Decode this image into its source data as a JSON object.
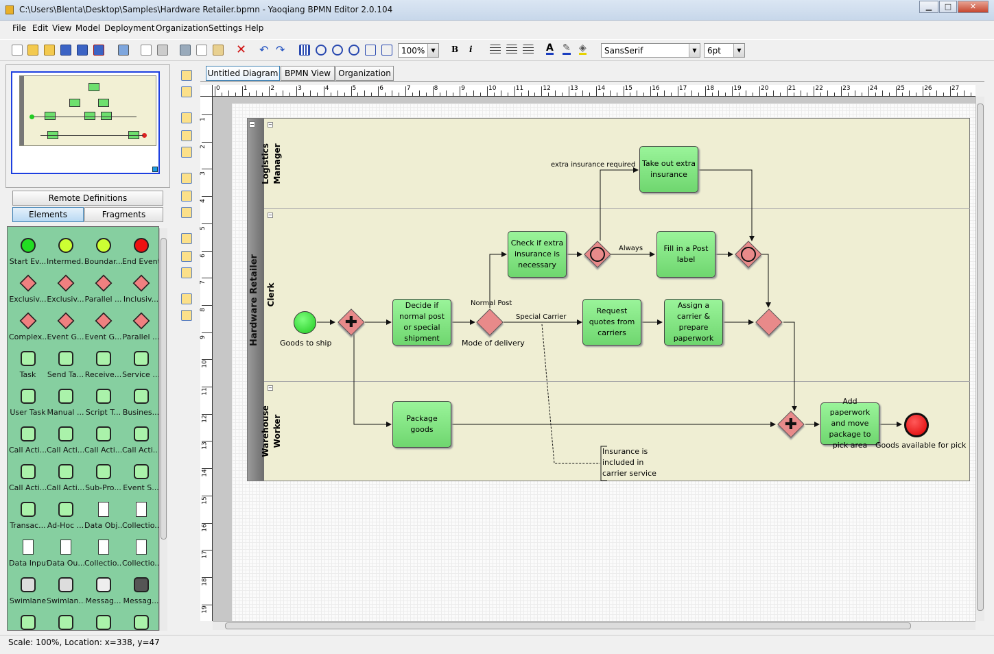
{
  "window": {
    "title": "C:\\Users\\Blenta\\Desktop\\Samples\\Hardware Retailer.bpmn - Yaoqiang BPMN Editor 2.0.104",
    "min": "▁",
    "max": "□",
    "close": "✕"
  },
  "menu": [
    "File",
    "Edit",
    "View",
    "Model",
    "Deployment",
    "Organization",
    "Settings",
    "Help"
  ],
  "toolbar": {
    "zoom": "100%",
    "font": "SansSerif",
    "size": "6pt",
    "bold": "B",
    "italic": "i",
    "dropdown": "▼"
  },
  "left": {
    "remote": "Remote Definitions",
    "tabs": [
      "Elements",
      "Fragments"
    ]
  },
  "palette": [
    {
      "label": "Start Ev...",
      "color": "#22dd22",
      "icon": "start-event-icon"
    },
    {
      "label": "Intermed...",
      "color": "#ccff33",
      "icon": "intermediate-event-icon"
    },
    {
      "label": "Boundar...",
      "color": "#ccff33",
      "icon": "boundary-event-icon"
    },
    {
      "label": "End Event",
      "color": "#ee1111",
      "icon": "end-event-icon"
    },
    {
      "label": "Exclusiv...",
      "color": "#f08080",
      "icon": "exclusive-gateway-icon"
    },
    {
      "label": "Exclusiv...",
      "color": "#f08080",
      "icon": "exclusive-x-gateway-icon"
    },
    {
      "label": "Parallel ...",
      "color": "#f08080",
      "icon": "parallel-gateway-icon"
    },
    {
      "label": "Inclusiv...",
      "color": "#f08080",
      "icon": "inclusive-gateway-icon"
    },
    {
      "label": "Complex...",
      "color": "#f08080",
      "icon": "complex-gateway-icon"
    },
    {
      "label": "Event G...",
      "color": "#f08080",
      "icon": "event-gateway-icon"
    },
    {
      "label": "Event G...",
      "color": "#f08080",
      "icon": "event-gateway-2-icon"
    },
    {
      "label": "Parallel ...",
      "color": "#f08080",
      "icon": "parallel-event-gateway-icon"
    },
    {
      "label": "Task",
      "color": "#aaf2aa",
      "icon": "task-icon"
    },
    {
      "label": "Send Ta...",
      "color": "#aaf2aa",
      "icon": "send-task-icon"
    },
    {
      "label": "Receive...",
      "color": "#aaf2aa",
      "icon": "receive-task-icon"
    },
    {
      "label": "Service ...",
      "color": "#aaf2aa",
      "icon": "service-task-icon"
    },
    {
      "label": "User Task",
      "color": "#aaf2aa",
      "icon": "user-task-icon"
    },
    {
      "label": "Manual ...",
      "color": "#aaf2aa",
      "icon": "manual-task-icon"
    },
    {
      "label": "Script T...",
      "color": "#aaf2aa",
      "icon": "script-task-icon"
    },
    {
      "label": "Busines...",
      "color": "#aaf2aa",
      "icon": "business-rule-task-icon"
    },
    {
      "label": "Call Acti...",
      "color": "#aaf2aa",
      "icon": "call-activity-icon"
    },
    {
      "label": "Call Acti...",
      "color": "#aaf2aa",
      "icon": "call-activity-user-icon"
    },
    {
      "label": "Call Acti...",
      "color": "#aaf2aa",
      "icon": "call-activity-manual-icon"
    },
    {
      "label": "Call Acti...",
      "color": "#aaf2aa",
      "icon": "call-activity-script-icon"
    },
    {
      "label": "Call Acti...",
      "color": "#aaf2aa",
      "icon": "call-activity-rule-icon"
    },
    {
      "label": "Call Acti...",
      "color": "#aaf2aa",
      "icon": "call-activity-process-icon"
    },
    {
      "label": "Sub-Pro...",
      "color": "#aaf2aa",
      "icon": "sub-process-icon"
    },
    {
      "label": "Event S...",
      "color": "#aaf2aa",
      "icon": "event-sub-process-icon"
    },
    {
      "label": "Transac...",
      "color": "#aaf2aa",
      "icon": "transaction-icon"
    },
    {
      "label": "Ad-Hoc ...",
      "color": "#aaf2aa",
      "icon": "ad-hoc-icon"
    },
    {
      "label": "Data Obj...",
      "color": "#ffffff",
      "icon": "data-object-icon"
    },
    {
      "label": "Collectio...",
      "color": "#ffffff",
      "icon": "data-collection-icon"
    },
    {
      "label": "Data Input",
      "color": "#ffffff",
      "icon": "data-input-icon"
    },
    {
      "label": "Data Ou...",
      "color": "#ffffff",
      "icon": "data-output-icon"
    },
    {
      "label": "Collectio...",
      "color": "#ffffff",
      "icon": "input-collection-icon"
    },
    {
      "label": "Collectio...",
      "color": "#ffffff",
      "icon": "output-collection-icon"
    },
    {
      "label": "Swimlane",
      "color": "#dddddd",
      "icon": "swimlane-icon"
    },
    {
      "label": "Swimlan...",
      "color": "#dddddd",
      "icon": "swimlane-vertical-icon"
    },
    {
      "label": "Messag...",
      "color": "#eeeeee",
      "icon": "message-icon"
    },
    {
      "label": "Messag...",
      "color": "#555555",
      "icon": "message-filled-icon"
    },
    {
      "label": "",
      "color": "#aaf2aa",
      "icon": "task-partial-icon"
    },
    {
      "label": "",
      "color": "#aaf2aa",
      "icon": "task-partial-2-icon"
    },
    {
      "label": "",
      "color": "#aaf2aa",
      "icon": "task-partial-3-icon"
    },
    {
      "label": "",
      "color": "#aaf2aa",
      "icon": "task-partial-4-icon"
    }
  ],
  "tabs": [
    "Untitled Diagram",
    "BPMN View",
    "Organization"
  ],
  "ruler": [
    "0",
    "1",
    "2",
    "3",
    "4",
    "5",
    "6",
    "7",
    "8",
    "9",
    "10",
    "11",
    "12",
    "13",
    "14",
    "15",
    "16",
    "17",
    "18",
    "19",
    "20",
    "21",
    "22",
    "23",
    "24",
    "25",
    "26",
    "27"
  ],
  "vruler": [
    "1",
    "2",
    "3",
    "4",
    "5",
    "6",
    "7",
    "8",
    "9",
    "10",
    "11",
    "12",
    "13",
    "14",
    "15",
    "16",
    "17",
    "18",
    "19"
  ],
  "diagram": {
    "pool": "Hardware Retailer",
    "lanes": [
      "Logistics\nManager",
      "Clerk",
      "Warehouse\nWorker"
    ],
    "tasks": {
      "decide": "Decide if normal post or special shipment",
      "check": "Check if extra insurance is necessary",
      "take": "Take out extra insurance",
      "fill": "Fill in a Post label",
      "quotes": "Request quotes from carriers",
      "assign": "Assign a carrier & prepare paperwork",
      "package": "Package goods",
      "add": "Add paperwork and move package to pick area"
    },
    "labels": {
      "start": "Goods  to ship",
      "mode": "Mode of delivery",
      "normal": "Normal Post",
      "special": "Special Carrier",
      "extra": "extra insurance required",
      "always": "Always",
      "end": "Goods available  for pick",
      "annotation": "Insurance is included in carrier service"
    }
  },
  "status": "Scale: 100%, Location: x=338, y=47"
}
